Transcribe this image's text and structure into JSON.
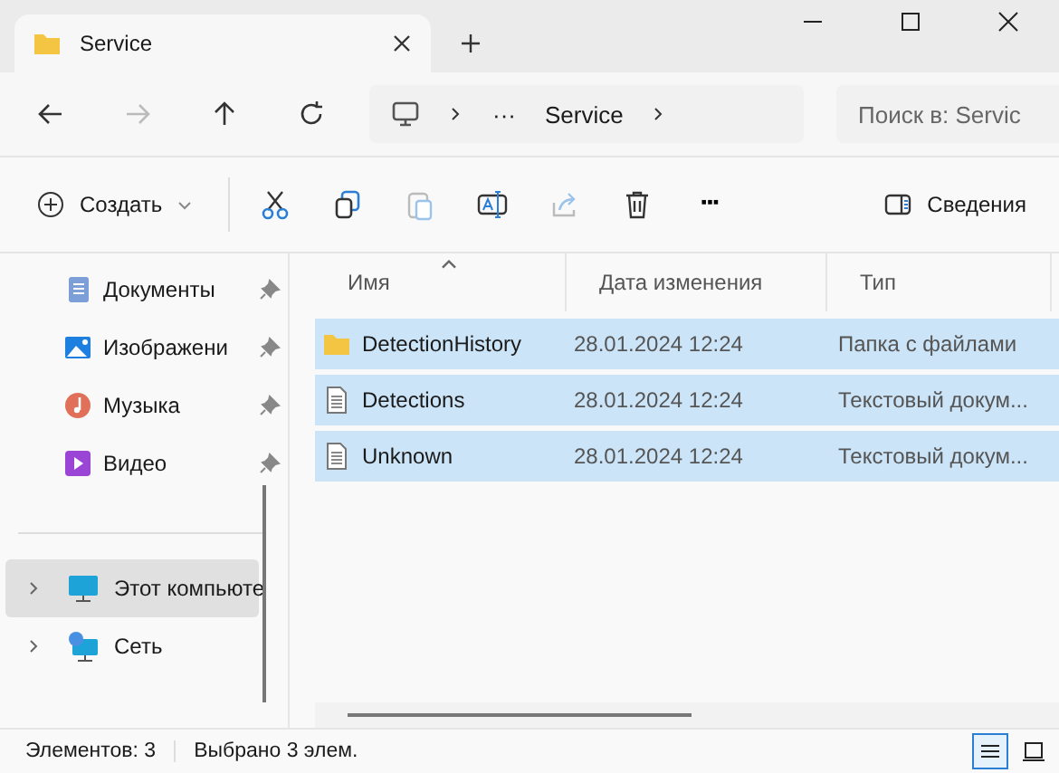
{
  "tab": {
    "title": "Service"
  },
  "address": {
    "ellipsis": "···",
    "crumb": "Service"
  },
  "search": {
    "placeholder": "Поиск в: Servic"
  },
  "toolbar": {
    "create": "Создать",
    "more": "···",
    "details": "Сведения"
  },
  "sidebar": {
    "quick": [
      {
        "label": "Документы",
        "pinned": true
      },
      {
        "label": "Изображени",
        "pinned": true
      },
      {
        "label": "Музыка",
        "pinned": true
      },
      {
        "label": "Видео",
        "pinned": true
      }
    ],
    "tree": [
      {
        "label": "Этот компьюте",
        "selected": true
      },
      {
        "label": "Сеть",
        "selected": false
      }
    ]
  },
  "table": {
    "columns": [
      "Имя",
      "Дата изменения",
      "Тип"
    ],
    "rows": [
      {
        "kind": "folder",
        "name": "DetectionHistory",
        "date": "28.01.2024 12:24",
        "type": "Папка с файлами",
        "selected": true
      },
      {
        "kind": "file",
        "name": "Detections",
        "date": "28.01.2024 12:24",
        "type": "Текстовый докум...",
        "selected": true
      },
      {
        "kind": "file",
        "name": "Unknown",
        "date": "28.01.2024 12:24",
        "type": "Текстовый докум...",
        "selected": true
      }
    ]
  },
  "status_bar": {
    "items": "Элементов: 3",
    "selected": "Выбрано 3 элем.",
    "views": [
      {
        "kind": "details",
        "selected": true
      },
      {
        "kind": "tiles",
        "selected": false
      }
    ]
  }
}
